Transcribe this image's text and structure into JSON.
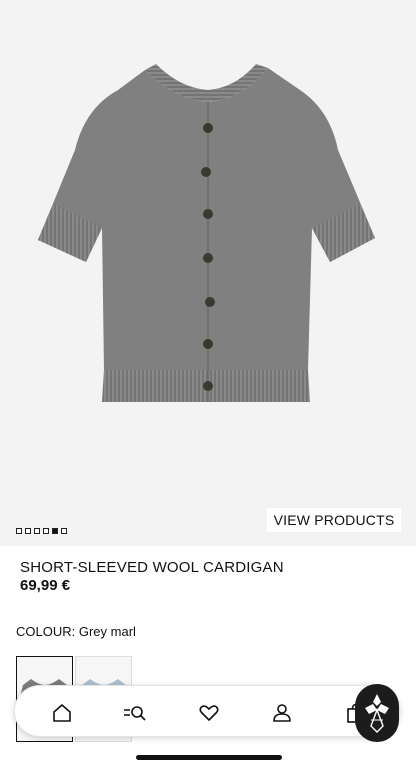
{
  "gallery": {
    "image_alt": "Grey short-sleeved wool cardigan",
    "dots_total": 6,
    "dots_active_index": 4,
    "view_products_label": "VIEW PRODUCTS"
  },
  "product": {
    "title": "SHORT-SLEEVED WOOL CARDIGAN",
    "price": "69,99 €"
  },
  "colour": {
    "label": "COLOUR:",
    "value": "Grey marl"
  },
  "swatches": [
    {
      "name": "grey-marl",
      "color": "#7c7c7c"
    },
    {
      "name": "light-blue",
      "color": "#a9bfcf"
    }
  ],
  "navbar": {
    "items": [
      {
        "icon": "home-icon"
      },
      {
        "icon": "search-icon"
      },
      {
        "icon": "heart-icon"
      },
      {
        "icon": "user-icon"
      },
      {
        "icon": "bag-icon"
      }
    ]
  },
  "colors": {
    "garment": "#7f7f7f",
    "background": "#f3f3f3",
    "fab": "#1c1c1c"
  }
}
